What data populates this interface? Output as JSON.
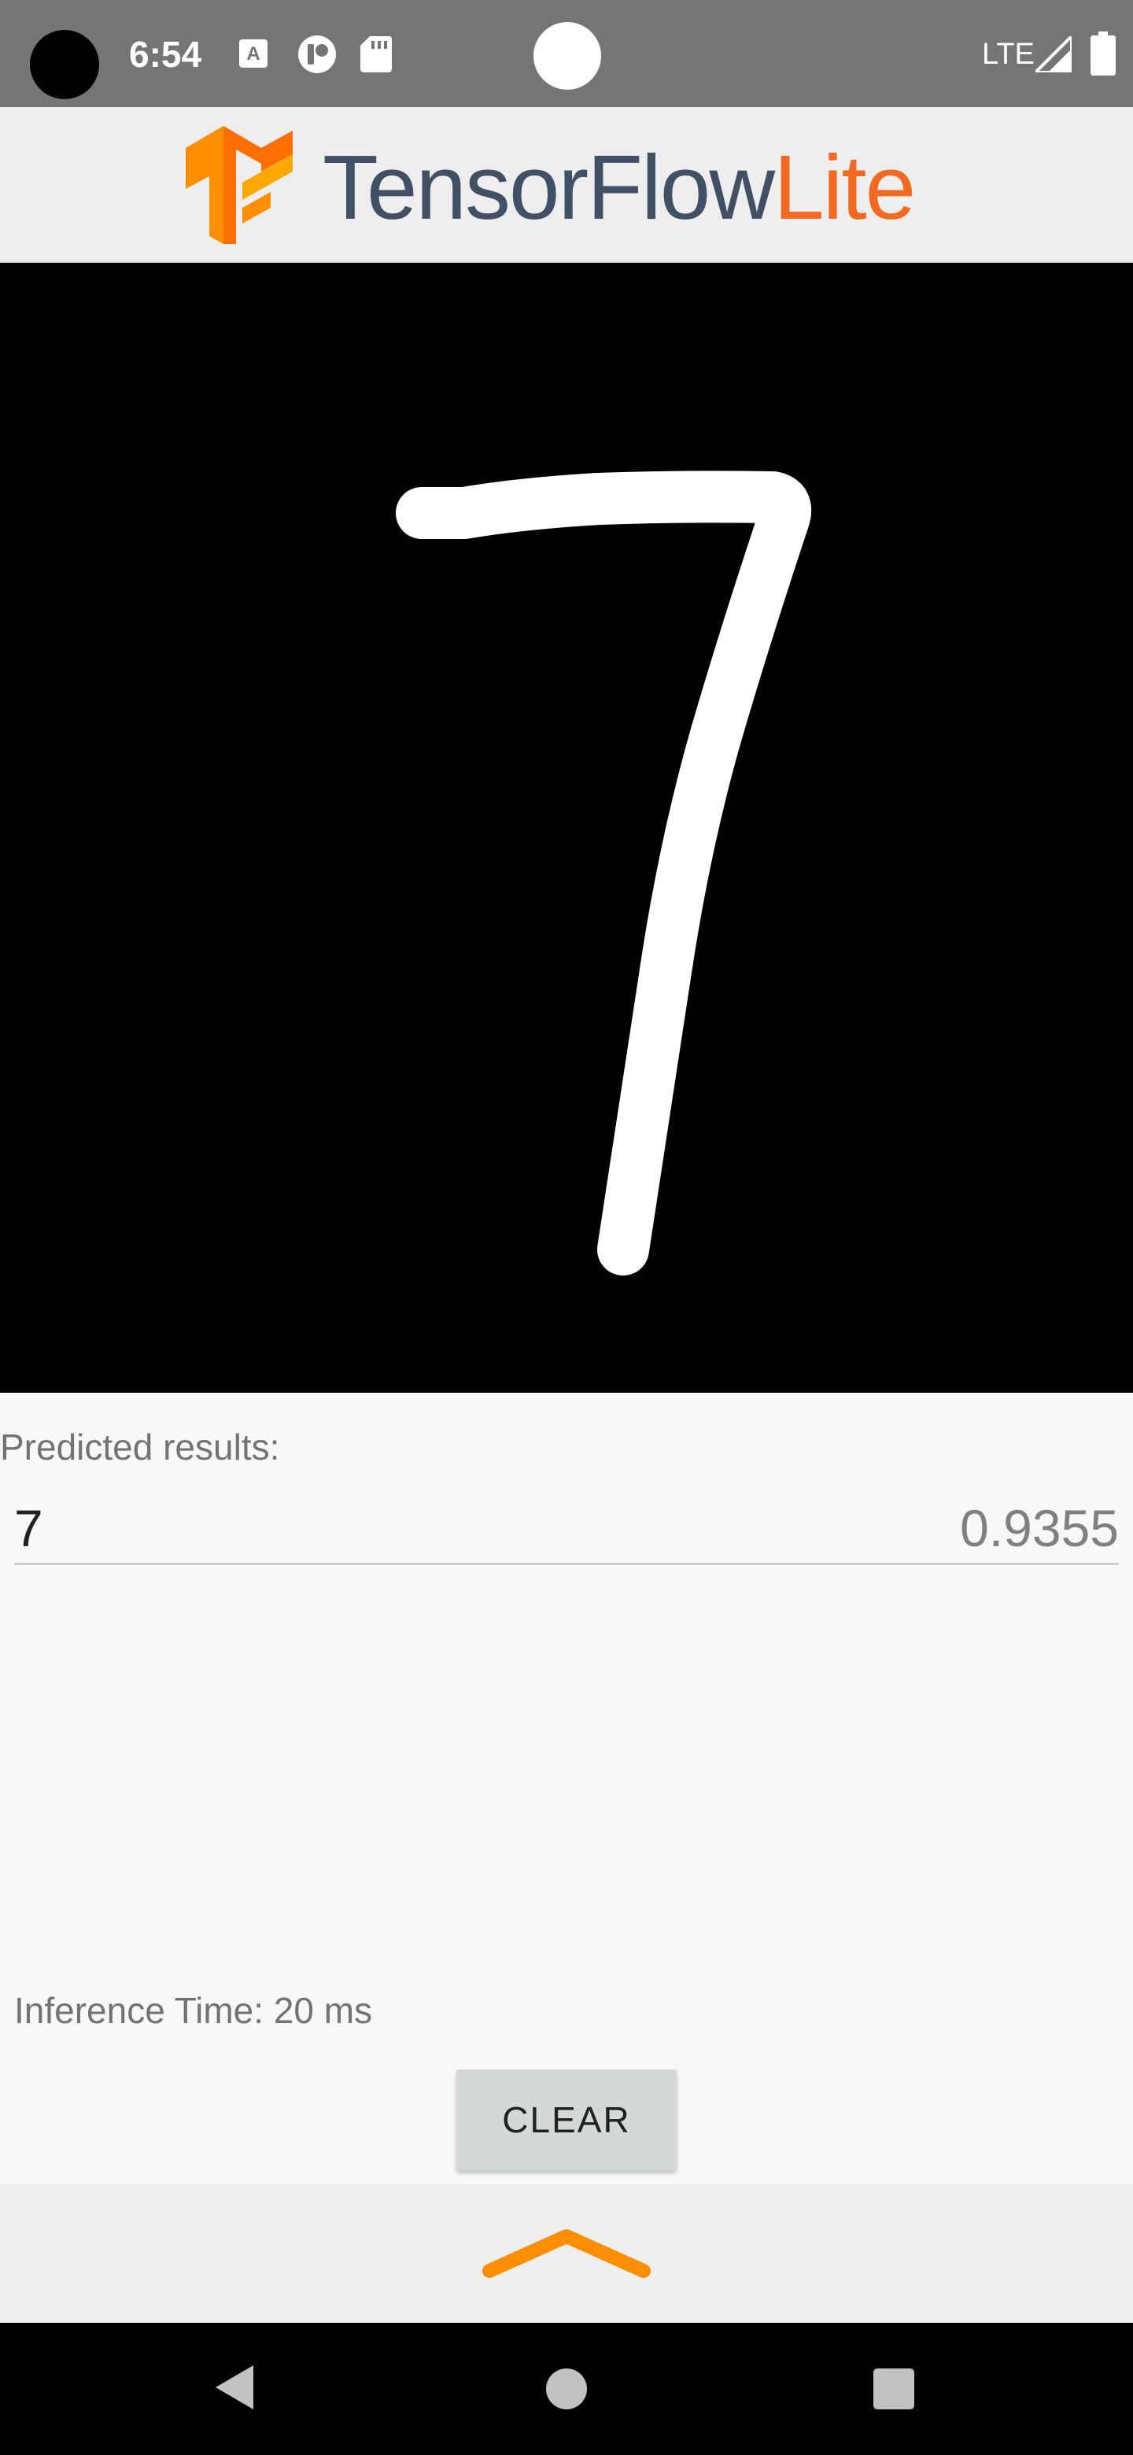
{
  "status_bar": {
    "time": "6:54",
    "network": "LTE",
    "icons": [
      "camera-cutout-icon",
      "a-notification-icon",
      "cast-notification-icon",
      "sd-card-icon",
      "record-dot-icon",
      "signal-icon",
      "battery-icon"
    ]
  },
  "header": {
    "brand_word_1": "TensorFlow",
    "brand_word_2": "Lite",
    "brand_colors": {
      "tensorflow": "#425066",
      "lite": "#f26a21",
      "logo_orange": "#ff8f00"
    }
  },
  "canvas": {
    "drawn_digit_description_icon": "handwritten-seven-stroke",
    "background": "#000000",
    "stroke_color": "#ffffff"
  },
  "results": {
    "label": "Predicted results:",
    "top_digit": "7",
    "top_score": "0.9355"
  },
  "inference": {
    "text": "Inference Time: 20 ms"
  },
  "actions": {
    "clear_label": "CLEAR"
  },
  "bottom_sheet": {
    "handle_icon": "chevron-up-icon",
    "accent": "#ff8f00"
  },
  "nav": {
    "icons": [
      "back-icon",
      "home-icon",
      "recents-icon"
    ]
  }
}
